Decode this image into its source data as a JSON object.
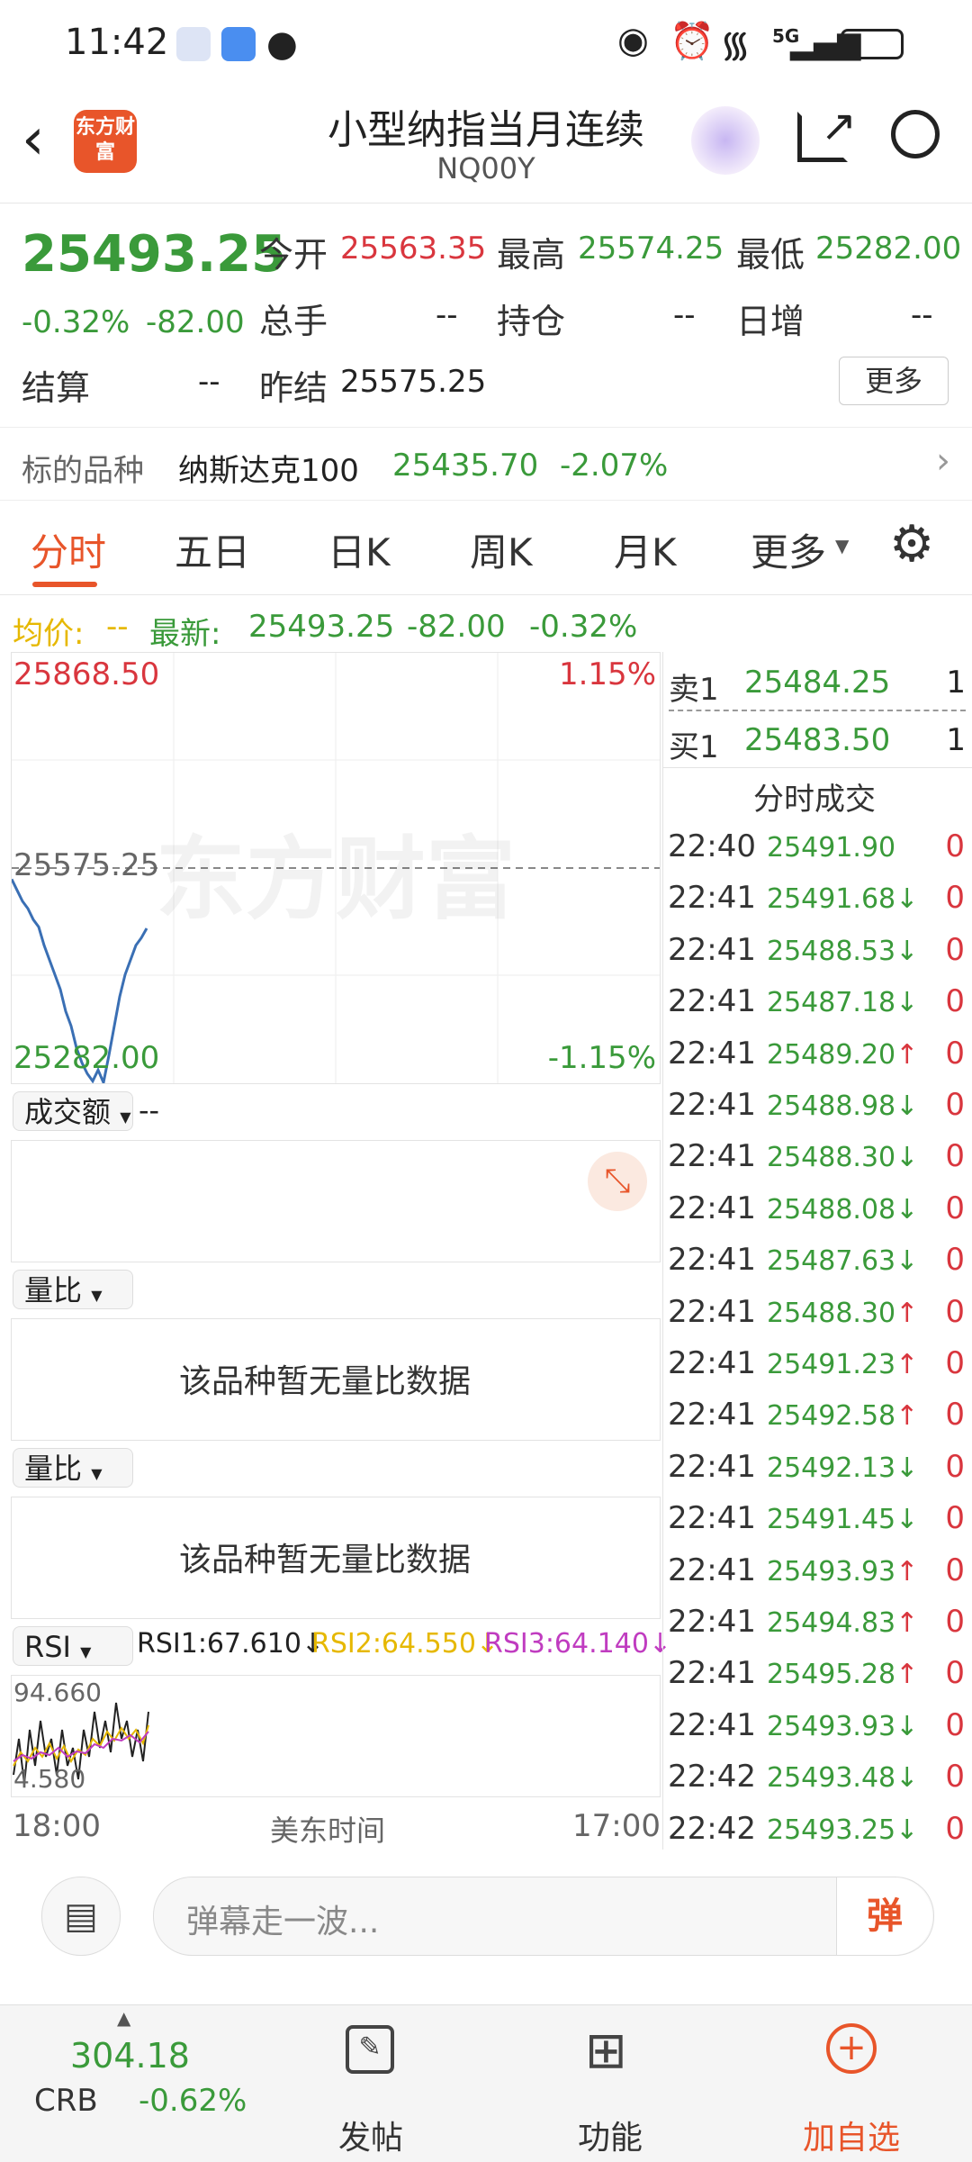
{
  "status": {
    "time": "11:42",
    "network": "5G"
  },
  "header": {
    "title": "小型纳指当月连续",
    "code": "NQ00Y",
    "logo_text": "东方财富"
  },
  "quote": {
    "price": "25493.25",
    "change_pct": "-0.32%",
    "change": "-82.00",
    "open_label": "今开",
    "open": "25563.35",
    "high_label": "最高",
    "high": "25574.25",
    "low_label": "最低",
    "low": "25282.00",
    "volume_label": "总手",
    "volume": "--",
    "oi_label": "持仓",
    "oi": "--",
    "daily_inc_label": "日增",
    "daily_inc": "--",
    "settle_label": "结算",
    "settle": "--",
    "prev_settle_label": "昨结",
    "prev_settle": "25575.25",
    "more_label": "更多"
  },
  "underlying": {
    "label": "标的品种",
    "name": "纳斯达克100",
    "price": "25435.70",
    "change_pct": "-2.07%"
  },
  "tabs": [
    "分时",
    "五日",
    "日K",
    "周K",
    "月K",
    "更多"
  ],
  "avg_bar": {
    "avg_label": "均价:",
    "avg_value": "--",
    "latest_label": "最新:",
    "latest": "25493.25",
    "change": "-82.00",
    "change_pct": "-0.32%"
  },
  "chart": {
    "top_price": "25868.50",
    "top_pct": "1.15%",
    "mid_price": "25575.25",
    "bottom_price": "25282.00",
    "bottom_pct": "-1.15%",
    "watermark": "东方财富"
  },
  "chart_data": {
    "type": "line",
    "title": "",
    "ylim": [
      25282.0,
      25868.5
    ],
    "reference": 25575.25,
    "values": [
      25560,
      25545,
      25530,
      25520,
      25505,
      25495,
      25470,
      25450,
      25430,
      25410,
      25380,
      25360,
      25330,
      25310,
      25295,
      25285,
      25300,
      25283,
      25320,
      25360,
      25400,
      25430,
      25450,
      25470,
      25480,
      25493
    ]
  },
  "volume_panel": {
    "selector": "成交额",
    "value": "--"
  },
  "ratio_panels": [
    {
      "selector": "量比",
      "empty_text": "该品种暂无量比数据"
    },
    {
      "selector": "量比",
      "empty_text": "该品种暂无量比数据"
    }
  ],
  "rsi": {
    "selector": "RSI",
    "rsi1": "RSI1:67.610",
    "rsi2": "RSI2:64.550",
    "rsi3": "RSI3:64.140",
    "top": "94.660",
    "bottom": "4.580"
  },
  "time_axis": {
    "start": "18:00",
    "mid": "美东时间",
    "end": "17:00"
  },
  "orderbook": {
    "ask_label": "卖1",
    "ask_price": "25484.25",
    "ask_vol": "1",
    "bid_label": "买1",
    "bid_price": "25483.50",
    "bid_vol": "1"
  },
  "trades_title": "分时成交",
  "trades": [
    {
      "time": "22:40",
      "price": "25491.90",
      "dir": "",
      "vol": "0"
    },
    {
      "time": "22:41",
      "price": "25491.68",
      "dir": "↓",
      "vol": "0"
    },
    {
      "time": "22:41",
      "price": "25488.53",
      "dir": "↓",
      "vol": "0"
    },
    {
      "time": "22:41",
      "price": "25487.18",
      "dir": "↓",
      "vol": "0"
    },
    {
      "time": "22:41",
      "price": "25489.20",
      "dir": "↑",
      "vol": "0"
    },
    {
      "time": "22:41",
      "price": "25488.98",
      "dir": "↓",
      "vol": "0"
    },
    {
      "time": "22:41",
      "price": "25488.30",
      "dir": "↓",
      "vol": "0"
    },
    {
      "time": "22:41",
      "price": "25488.08",
      "dir": "↓",
      "vol": "0"
    },
    {
      "time": "22:41",
      "price": "25487.63",
      "dir": "↓",
      "vol": "0"
    },
    {
      "time": "22:41",
      "price": "25488.30",
      "dir": "↑",
      "vol": "0"
    },
    {
      "time": "22:41",
      "price": "25491.23",
      "dir": "↑",
      "vol": "0"
    },
    {
      "time": "22:41",
      "price": "25492.58",
      "dir": "↑",
      "vol": "0"
    },
    {
      "time": "22:41",
      "price": "25492.13",
      "dir": "↓",
      "vol": "0"
    },
    {
      "time": "22:41",
      "price": "25491.45",
      "dir": "↓",
      "vol": "0"
    },
    {
      "time": "22:41",
      "price": "25493.93",
      "dir": "↑",
      "vol": "0"
    },
    {
      "time": "22:41",
      "price": "25494.83",
      "dir": "↑",
      "vol": "0"
    },
    {
      "time": "22:41",
      "price": "25495.28",
      "dir": "↑",
      "vol": "0"
    },
    {
      "time": "22:41",
      "price": "25493.93",
      "dir": "↓",
      "vol": "0"
    },
    {
      "time": "22:42",
      "price": "25493.48",
      "dir": "↓",
      "vol": "0"
    },
    {
      "time": "22:42",
      "price": "25493.25",
      "dir": "↓",
      "vol": "0"
    }
  ],
  "comment": {
    "placeholder": "弹幕走一波...",
    "danmu_label": "弹"
  },
  "bottom": {
    "crb_value": "304.18",
    "crb_label": "CRB",
    "crb_change": "-0.62%",
    "post_label": "发帖",
    "function_label": "功能",
    "add_label": "加自选"
  },
  "colors": {
    "up": "#d9363e",
    "down": "#3a9a3a",
    "accent": "#e8552a",
    "avg": "#e6b800"
  }
}
